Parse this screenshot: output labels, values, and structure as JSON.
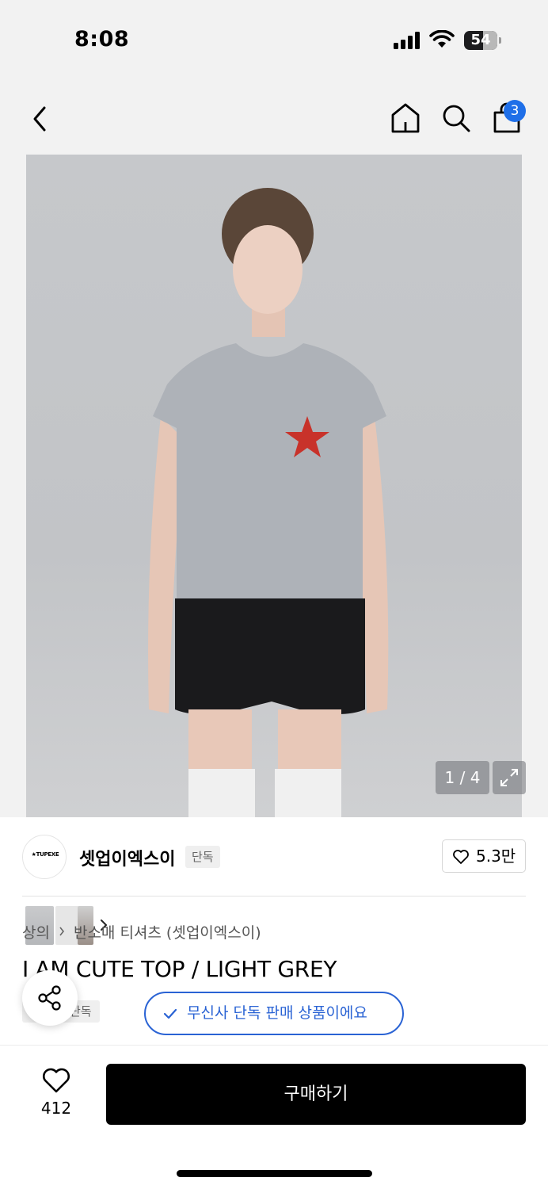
{
  "status_bar": {
    "time": "8:08",
    "battery": "54"
  },
  "header": {
    "icons": [
      "back-icon",
      "home-icon",
      "search-icon",
      "cart-icon"
    ],
    "cart_badge": "3"
  },
  "gallery": {
    "counter": "1 / 4",
    "accent_color": "#1f6fe8"
  },
  "brand": {
    "logo_text": "★TUPEXE",
    "name": "셋업이엑스이",
    "tag": "단독",
    "likes": "5.3만"
  },
  "product": {
    "breadcrumb": [
      "상의",
      "반소매 티셔츠 (셋업이엑스이)"
    ],
    "title": "I AM CUTE TOP / LIGHT GREY",
    "tag": "단독",
    "exclusive_label": "무신사 단독 판매 상품이에요",
    "exclusive_color": "#2a63d4"
  },
  "bottom_bar": {
    "wish_count": "412",
    "buy_label": "구매하기"
  }
}
